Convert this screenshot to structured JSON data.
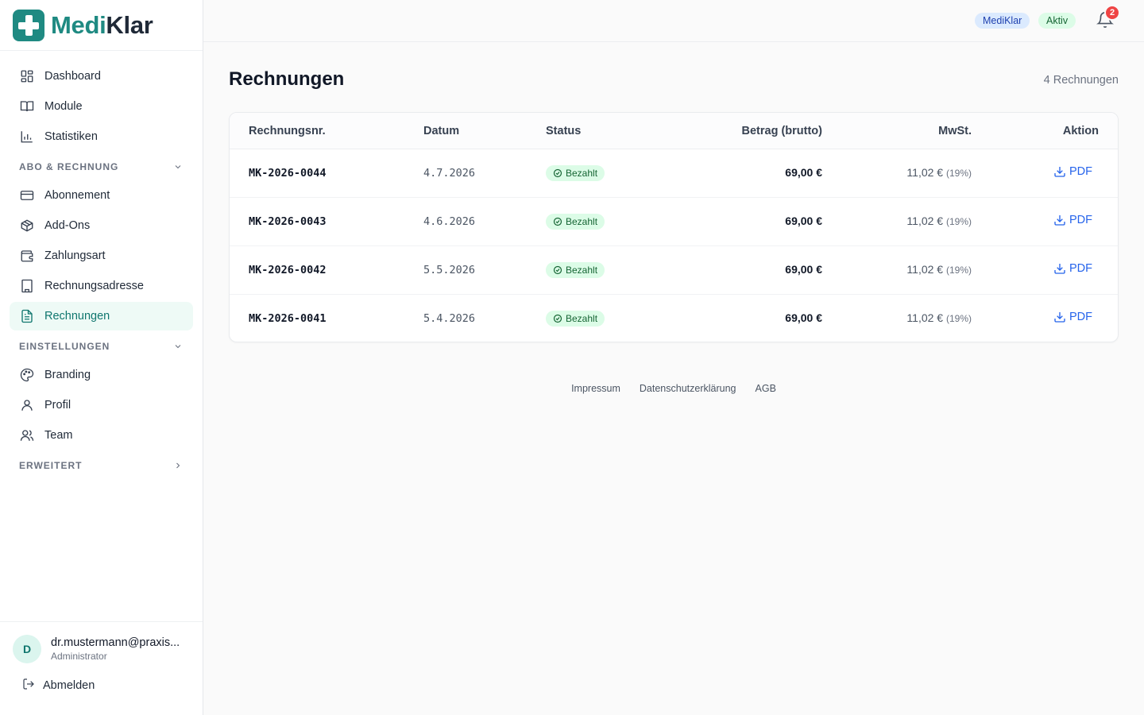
{
  "brand": {
    "name_part1": "Medi",
    "name_part2": "Klar"
  },
  "sidebar": {
    "top_items": [
      {
        "label": "Dashboard",
        "icon": "dashboard-icon"
      },
      {
        "label": "Module",
        "icon": "book-icon"
      },
      {
        "label": "Statistiken",
        "icon": "bar-chart-icon"
      }
    ],
    "sections": [
      {
        "title": "ABO & RECHNUNG",
        "expanded": true,
        "items": [
          {
            "label": "Abonnement",
            "icon": "credit-card-icon"
          },
          {
            "label": "Add-Ons",
            "icon": "package-icon"
          },
          {
            "label": "Zahlungsart",
            "icon": "wallet-icon"
          },
          {
            "label": "Rechnungsadresse",
            "icon": "building-icon"
          },
          {
            "label": "Rechnungen",
            "icon": "file-text-icon",
            "active": true
          }
        ]
      },
      {
        "title": "EINSTELLUNGEN",
        "expanded": true,
        "items": [
          {
            "label": "Branding",
            "icon": "palette-icon"
          },
          {
            "label": "Profil",
            "icon": "user-icon"
          },
          {
            "label": "Team",
            "icon": "users-icon"
          }
        ]
      },
      {
        "title": "ERWEITERT",
        "expanded": false,
        "items": []
      }
    ],
    "user": {
      "initial": "D",
      "email": "dr.mustermann@praxis...",
      "role": "Administrator"
    },
    "logout_label": "Abmelden"
  },
  "header": {
    "brand_pill": "MediKlar",
    "status_pill": "Aktiv",
    "notification_count": "2"
  },
  "main": {
    "title": "Rechnungen",
    "count_label": "4 Rechnungen",
    "columns": [
      "Rechnungsnr.",
      "Datum",
      "Status",
      "Betrag (brutto)",
      "MwSt.",
      "Aktion"
    ],
    "rows": [
      {
        "nr": "MK-2026-0044",
        "date": "4.7.2026",
        "status": "Bezahlt",
        "amount": "69,00 €",
        "tax": "11,02 €",
        "tax_pct": "(19%)",
        "action": "PDF"
      },
      {
        "nr": "MK-2026-0043",
        "date": "4.6.2026",
        "status": "Bezahlt",
        "amount": "69,00 €",
        "tax": "11,02 €",
        "tax_pct": "(19%)",
        "action": "PDF"
      },
      {
        "nr": "MK-2026-0042",
        "date": "5.5.2026",
        "status": "Bezahlt",
        "amount": "69,00 €",
        "tax": "11,02 €",
        "tax_pct": "(19%)",
        "action": "PDF"
      },
      {
        "nr": "MK-2026-0041",
        "date": "5.4.2026",
        "status": "Bezahlt",
        "amount": "69,00 €",
        "tax": "11,02 €",
        "tax_pct": "(19%)",
        "action": "PDF"
      }
    ]
  },
  "footer": {
    "links": [
      "Impressum",
      "Datenschutzerklärung",
      "AGB"
    ]
  },
  "colors": {
    "brand": "#1f8a82",
    "active_bg": "#eefaf6",
    "link": "#2563eb",
    "paid_bg": "#dcfce7",
    "paid_text": "#166534",
    "badge": "#ef4444"
  }
}
